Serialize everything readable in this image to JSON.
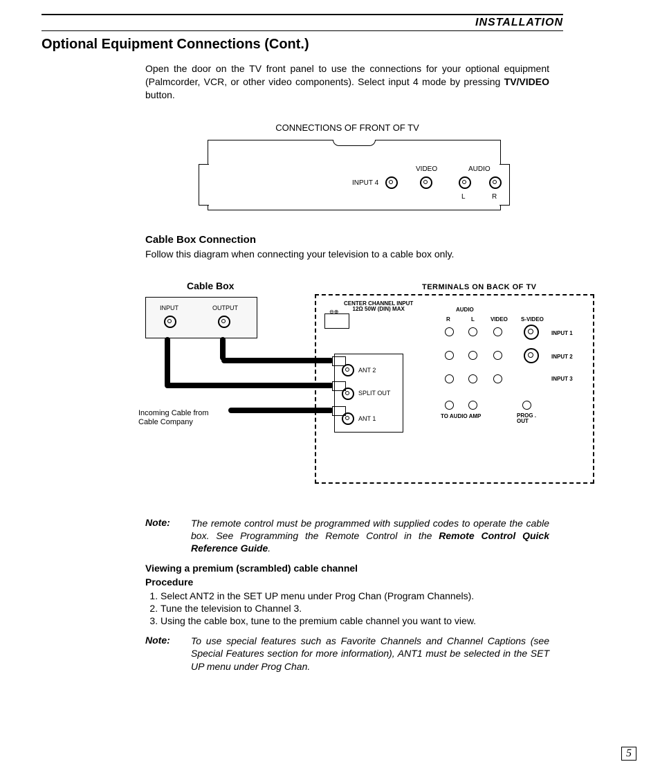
{
  "header": {
    "section": "INSTALLATION"
  },
  "title": "Optional Equipment Connections (Cont.)",
  "intro": {
    "pre": "Open the door on the TV front panel to use the connections for your optional equipment (Palmcorder, VCR, or other video components). Select  input 4 mode by pressing ",
    "bold": "TV/VIDEO",
    "post": " button."
  },
  "front_diagram": {
    "title": "CONNECTIONS OF FRONT OF TV",
    "input_label": "INPUT 4",
    "video_label": "VIDEO",
    "audio_label": "AUDIO",
    "l": "L",
    "r": "R"
  },
  "cable_section": {
    "heading": "Cable Box Connection",
    "text": "Follow this diagram when connecting your television to a cable box only."
  },
  "diagram2": {
    "cable_box_title": "Cable Box",
    "terminals_title": "TERMINALS ON BACK OF TV",
    "cb_input": "INPUT",
    "cb_output": "OUTPUT",
    "incoming": "Incoming Cable from Cable Company",
    "cci_line1": "CENTER CHANNEL INPUT",
    "cci_line2": "12Ω   50W  (DIN) MAX",
    "ant2": "ANT 2",
    "split": "SPLIT OUT",
    "ant1": "ANT 1",
    "audio": "AUDIO",
    "r": "R",
    "l": "L",
    "video": "VIDEO",
    "svideo": "S-VIDEO",
    "input1": "INPUT 1",
    "input2": "INPUT 2",
    "input3": "INPUT 3",
    "to_audio": "TO AUDIO AMP",
    "prog_out": "PROG . OUT"
  },
  "note1": {
    "label": "Note:",
    "pre": "The remote control must be programmed with supplied codes to operate the cable box. See Programming the Remote Control in the ",
    "bold": "Remote Control Quick Reference Guide",
    "post": "."
  },
  "viewing": {
    "heading": "Viewing a premium (scrambled) cable channel",
    "procedure_label": "Procedure",
    "steps": [
      "Select ANT2 in the SET UP menu under Prog Chan (Program Channels).",
      "Tune the television to Channel 3.",
      "Using the cable box, tune to the premium cable channel you want to view."
    ]
  },
  "note2": {
    "label": "Note:",
    "text": "To use special features such as Favorite Channels and Channel Captions (see Special Features section for more information), ANT1 must be selected in the SET UP menu under Prog Chan."
  },
  "page_number": "5"
}
